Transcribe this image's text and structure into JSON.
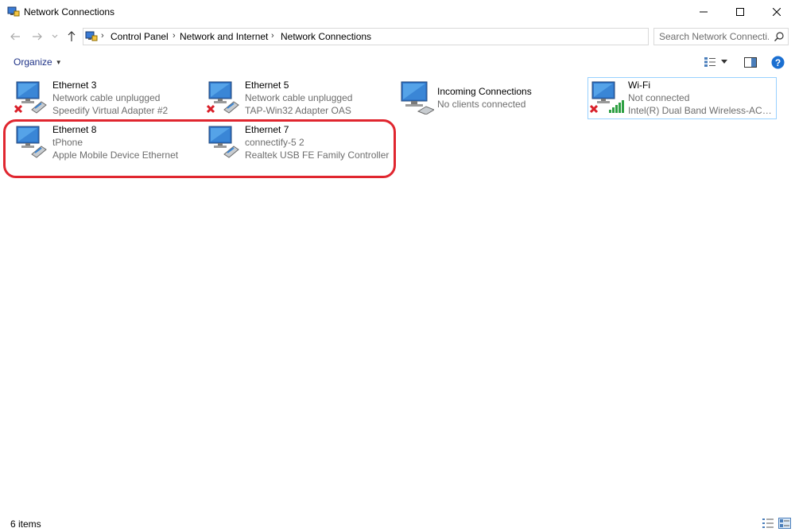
{
  "window": {
    "title": "Network Connections"
  },
  "address": {
    "crumbs": [
      "Control Panel",
      "Network and Internet",
      "Network Connections"
    ]
  },
  "search": {
    "placeholder": "Search Network Connecti..."
  },
  "toolbar": {
    "organize_label": "Organize"
  },
  "connections": [
    {
      "name": "Ethernet 3",
      "status": "Network cable unplugged",
      "device": "Speedify Virtual Adapter #2",
      "type": "ethernet",
      "disconnected": true
    },
    {
      "name": "Ethernet 5",
      "status": "Network cable unplugged",
      "device": "TAP-Win32 Adapter OAS",
      "type": "ethernet",
      "disconnected": true
    },
    {
      "name": "Incoming Connections",
      "status": "No clients connected",
      "device": "",
      "type": "incoming",
      "disconnected": false
    },
    {
      "name": "Wi-Fi",
      "status": "Not connected",
      "device": "Intel(R) Dual Band Wireless-AC 72...",
      "type": "wifi",
      "disconnected": true
    },
    {
      "name": "Ethernet 8",
      "status": "tPhone",
      "device": "Apple Mobile Device Ethernet",
      "type": "ethernet",
      "disconnected": false
    },
    {
      "name": "Ethernet 7",
      "status": "connectify-5  2",
      "device": "Realtek USB FE Family Controller",
      "type": "ethernet",
      "disconnected": false
    }
  ],
  "statusbar": {
    "item_count": "6 items"
  },
  "colors": {
    "highlight": "#e0262f",
    "selection_border": "#99d1ff",
    "link": "#1e3287"
  }
}
